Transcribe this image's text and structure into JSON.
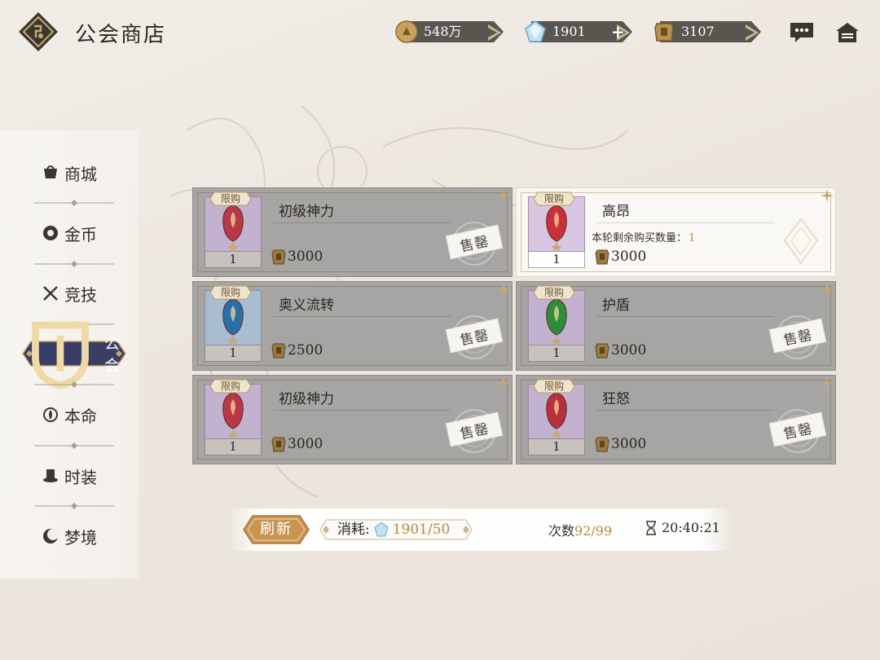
{
  "header": {
    "title": "公会商店",
    "currencies": [
      {
        "icon": "gold-coin-icon",
        "value": "548万"
      },
      {
        "icon": "diamond-gem-icon",
        "value": "1901",
        "add": "+"
      },
      {
        "icon": "guild-token-icon",
        "value": "3107"
      }
    ]
  },
  "sidebar": {
    "items": [
      {
        "label": "商城",
        "icon": "mall-icon"
      },
      {
        "label": "金币",
        "icon": "coin-icon"
      },
      {
        "label": "竞技",
        "icon": "crossed-swords-icon"
      },
      {
        "label": "公会",
        "icon": "guild-shield-icon",
        "active": true
      },
      {
        "label": "本命",
        "icon": "lotus-icon"
      },
      {
        "label": "时装",
        "icon": "hat-icon"
      },
      {
        "label": "梦境",
        "icon": "moon-icon"
      }
    ]
  },
  "shop": {
    "tag_label": "限购",
    "sold_out_label": "售罄",
    "remaining_label": "本轮剩余购买数量：",
    "items": [
      {
        "name": "初级神力",
        "qty": "1",
        "price": "3000",
        "color": "#b83848",
        "bg": "#c3b2cf",
        "sold_out": true
      },
      {
        "name": "高昂",
        "qty": "1",
        "price": "3000",
        "color": "#c8303a",
        "bg": "#d9c6e3",
        "sold_out": false,
        "remaining": "1"
      },
      {
        "name": "奥义流转",
        "qty": "1",
        "price": "2500",
        "color": "#2a6fa8",
        "bg": "#a9bdd0",
        "sold_out": true
      },
      {
        "name": "护盾",
        "qty": "1",
        "price": "3000",
        "color": "#2e8c3c",
        "bg": "#c3b2cf",
        "sold_out": true
      },
      {
        "name": "初级神力",
        "qty": "1",
        "price": "3000",
        "color": "#b83848",
        "bg": "#c3b2cf",
        "sold_out": true
      },
      {
        "name": "狂怒",
        "qty": "1",
        "price": "3000",
        "color": "#b8303e",
        "bg": "#c3b2cf",
        "sold_out": true
      }
    ]
  },
  "footer": {
    "refresh_label": "刷新",
    "cost_label": "消耗:",
    "cost_value": "1901/50",
    "count_label": "次数",
    "count_value": "92/99",
    "timer": "20:40:21"
  },
  "colors": {
    "accent_gold": "#c89454",
    "active_nav": "#3a3e66",
    "sold_out_card": "#a6a5a3"
  }
}
